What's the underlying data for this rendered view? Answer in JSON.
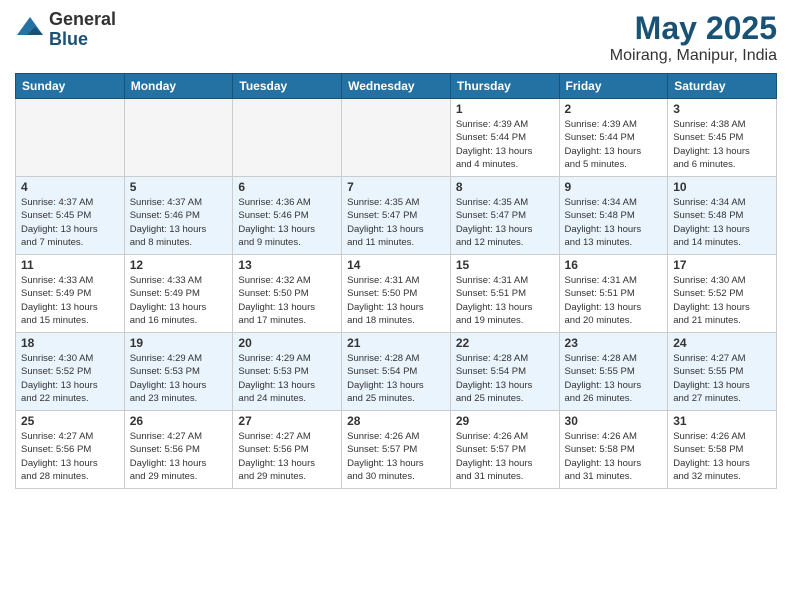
{
  "logo": {
    "general": "General",
    "blue": "Blue"
  },
  "title": "May 2025",
  "location": "Moirang, Manipur, India",
  "days_of_week": [
    "Sunday",
    "Monday",
    "Tuesday",
    "Wednesday",
    "Thursday",
    "Friday",
    "Saturday"
  ],
  "weeks": [
    [
      {
        "day": "",
        "info": ""
      },
      {
        "day": "",
        "info": ""
      },
      {
        "day": "",
        "info": ""
      },
      {
        "day": "",
        "info": ""
      },
      {
        "day": "1",
        "info": "Sunrise: 4:39 AM\nSunset: 5:44 PM\nDaylight: 13 hours\nand 4 minutes."
      },
      {
        "day": "2",
        "info": "Sunrise: 4:39 AM\nSunset: 5:44 PM\nDaylight: 13 hours\nand 5 minutes."
      },
      {
        "day": "3",
        "info": "Sunrise: 4:38 AM\nSunset: 5:45 PM\nDaylight: 13 hours\nand 6 minutes."
      }
    ],
    [
      {
        "day": "4",
        "info": "Sunrise: 4:37 AM\nSunset: 5:45 PM\nDaylight: 13 hours\nand 7 minutes."
      },
      {
        "day": "5",
        "info": "Sunrise: 4:37 AM\nSunset: 5:46 PM\nDaylight: 13 hours\nand 8 minutes."
      },
      {
        "day": "6",
        "info": "Sunrise: 4:36 AM\nSunset: 5:46 PM\nDaylight: 13 hours\nand 9 minutes."
      },
      {
        "day": "7",
        "info": "Sunrise: 4:35 AM\nSunset: 5:47 PM\nDaylight: 13 hours\nand 11 minutes."
      },
      {
        "day": "8",
        "info": "Sunrise: 4:35 AM\nSunset: 5:47 PM\nDaylight: 13 hours\nand 12 minutes."
      },
      {
        "day": "9",
        "info": "Sunrise: 4:34 AM\nSunset: 5:48 PM\nDaylight: 13 hours\nand 13 minutes."
      },
      {
        "day": "10",
        "info": "Sunrise: 4:34 AM\nSunset: 5:48 PM\nDaylight: 13 hours\nand 14 minutes."
      }
    ],
    [
      {
        "day": "11",
        "info": "Sunrise: 4:33 AM\nSunset: 5:49 PM\nDaylight: 13 hours\nand 15 minutes."
      },
      {
        "day": "12",
        "info": "Sunrise: 4:33 AM\nSunset: 5:49 PM\nDaylight: 13 hours\nand 16 minutes."
      },
      {
        "day": "13",
        "info": "Sunrise: 4:32 AM\nSunset: 5:50 PM\nDaylight: 13 hours\nand 17 minutes."
      },
      {
        "day": "14",
        "info": "Sunrise: 4:31 AM\nSunset: 5:50 PM\nDaylight: 13 hours\nand 18 minutes."
      },
      {
        "day": "15",
        "info": "Sunrise: 4:31 AM\nSunset: 5:51 PM\nDaylight: 13 hours\nand 19 minutes."
      },
      {
        "day": "16",
        "info": "Sunrise: 4:31 AM\nSunset: 5:51 PM\nDaylight: 13 hours\nand 20 minutes."
      },
      {
        "day": "17",
        "info": "Sunrise: 4:30 AM\nSunset: 5:52 PM\nDaylight: 13 hours\nand 21 minutes."
      }
    ],
    [
      {
        "day": "18",
        "info": "Sunrise: 4:30 AM\nSunset: 5:52 PM\nDaylight: 13 hours\nand 22 minutes."
      },
      {
        "day": "19",
        "info": "Sunrise: 4:29 AM\nSunset: 5:53 PM\nDaylight: 13 hours\nand 23 minutes."
      },
      {
        "day": "20",
        "info": "Sunrise: 4:29 AM\nSunset: 5:53 PM\nDaylight: 13 hours\nand 24 minutes."
      },
      {
        "day": "21",
        "info": "Sunrise: 4:28 AM\nSunset: 5:54 PM\nDaylight: 13 hours\nand 25 minutes."
      },
      {
        "day": "22",
        "info": "Sunrise: 4:28 AM\nSunset: 5:54 PM\nDaylight: 13 hours\nand 25 minutes."
      },
      {
        "day": "23",
        "info": "Sunrise: 4:28 AM\nSunset: 5:55 PM\nDaylight: 13 hours\nand 26 minutes."
      },
      {
        "day": "24",
        "info": "Sunrise: 4:27 AM\nSunset: 5:55 PM\nDaylight: 13 hours\nand 27 minutes."
      }
    ],
    [
      {
        "day": "25",
        "info": "Sunrise: 4:27 AM\nSunset: 5:56 PM\nDaylight: 13 hours\nand 28 minutes."
      },
      {
        "day": "26",
        "info": "Sunrise: 4:27 AM\nSunset: 5:56 PM\nDaylight: 13 hours\nand 29 minutes."
      },
      {
        "day": "27",
        "info": "Sunrise: 4:27 AM\nSunset: 5:56 PM\nDaylight: 13 hours\nand 29 minutes."
      },
      {
        "day": "28",
        "info": "Sunrise: 4:26 AM\nSunset: 5:57 PM\nDaylight: 13 hours\nand 30 minutes."
      },
      {
        "day": "29",
        "info": "Sunrise: 4:26 AM\nSunset: 5:57 PM\nDaylight: 13 hours\nand 31 minutes."
      },
      {
        "day": "30",
        "info": "Sunrise: 4:26 AM\nSunset: 5:58 PM\nDaylight: 13 hours\nand 31 minutes."
      },
      {
        "day": "31",
        "info": "Sunrise: 4:26 AM\nSunset: 5:58 PM\nDaylight: 13 hours\nand 32 minutes."
      }
    ]
  ]
}
